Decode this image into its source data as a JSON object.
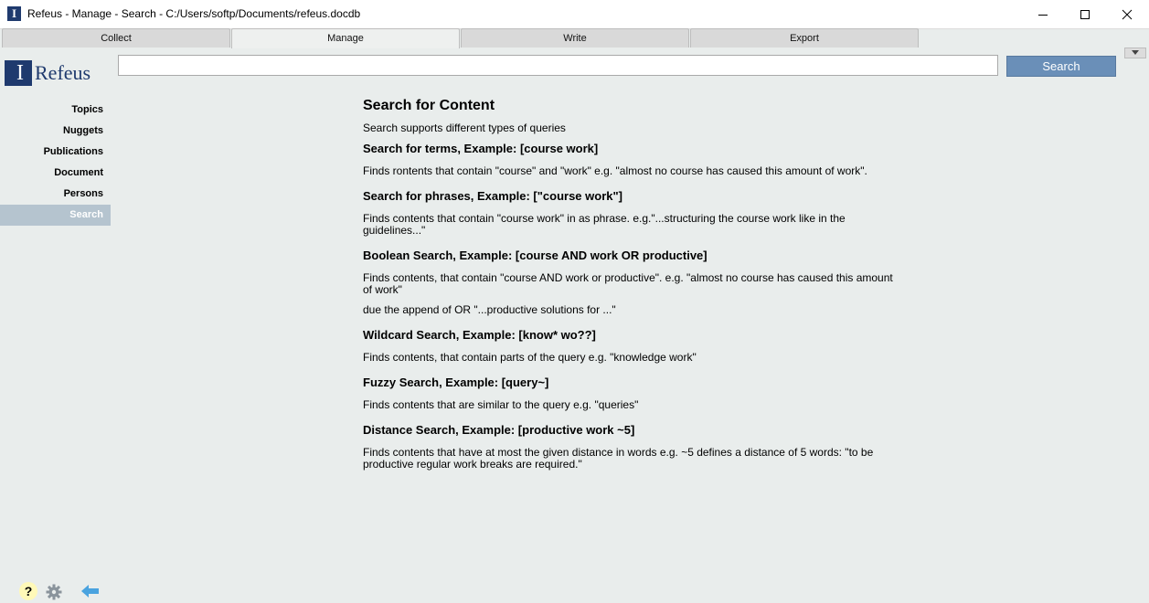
{
  "window": {
    "title": "Refeus - Manage - Search - C:/Users/softp/Documents/refeus.docdb",
    "icon_letter": "I"
  },
  "tabs": [
    {
      "label": "Collect"
    },
    {
      "label": "Manage"
    },
    {
      "label": "Write"
    },
    {
      "label": "Export"
    }
  ],
  "active_tab": "Manage",
  "logo": {
    "letter": "I",
    "word": "Refeus"
  },
  "search": {
    "value": "",
    "placeholder": "",
    "button_label": "Search"
  },
  "sidebar": {
    "items": [
      {
        "label": "Topics"
      },
      {
        "label": "Nuggets"
      },
      {
        "label": "Publications"
      },
      {
        "label": "Document"
      },
      {
        "label": "Persons"
      },
      {
        "label": "Search"
      }
    ],
    "active": "Search"
  },
  "content": {
    "title": "Search for Content",
    "intro": "Search supports different types of queries",
    "sections": [
      {
        "heading": "Search for terms, Example: [course work]",
        "body": "Finds rontents that contain \"course\" and \"work\" e.g. \"almost no course has caused this amount of work\"."
      },
      {
        "heading": "Search for phrases, Example: [\"course work\"]",
        "body": "Finds contents that contain \"course work\" in as phrase. e.g.\"...structuring the course work like in the guidelines...\""
      },
      {
        "heading": "Boolean Search, Example: [course AND work OR productive]",
        "body": "Finds contents, that contain \"course AND work or productive\". e.g. \"almost no course has caused this amount of work\"",
        "extra": "due the append of OR \"...productive solutions for ...\""
      },
      {
        "heading": "Wildcard Search, Example: [know* wo??]",
        "body": "Finds contents, that contain parts of the query e.g. \"knowledge work\""
      },
      {
        "heading": "Fuzzy Search, Example: [query~]",
        "body": "Finds contents that are similar to the query e.g. \"queries\""
      },
      {
        "heading": "Distance Search, Example: [productive work ~5]",
        "body": "Finds contents that have at most the given distance in words e.g. ~5 defines a distance of 5 words: \"to be productive regular work breaks are required.\""
      }
    ]
  },
  "footer": {
    "help_label": "?"
  },
  "icons": {
    "app": "refeus-app-icon",
    "minimize": "minimize-icon",
    "maximize": "maximize-icon",
    "close": "close-icon",
    "tab_menu": "chevron-down-icon",
    "help": "help-icon",
    "settings": "gear-icon",
    "back": "back-arrow-icon"
  },
  "colors": {
    "accent": "#6a8fb8",
    "logo_blue": "#1f3a6e",
    "sidebar_active": "#b5c4cf",
    "background": "#e9edec"
  }
}
